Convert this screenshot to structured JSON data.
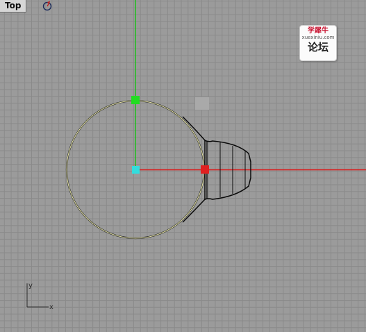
{
  "viewport": {
    "title": "Top",
    "background": "#9b9b9b",
    "grid_color": "#8a8a8a"
  },
  "watermark": {
    "line1": "学犀牛",
    "url": "xuexiniu.com",
    "line2": "论坛"
  },
  "axis_icon": {
    "x_label": "x",
    "y_label": "y"
  },
  "colors": {
    "x_axis": "#e01010",
    "y_axis": "#15c015",
    "selected_curve": "#e8e6a6",
    "curve": "#0a0a0a",
    "origin_point": "#33dddd"
  },
  "icons": {
    "view_options": "circular-arrow-icon"
  }
}
